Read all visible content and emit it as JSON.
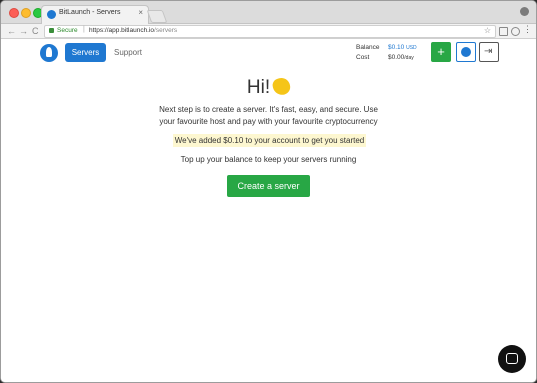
{
  "browser": {
    "tab_title": "BitLaunch - Servers",
    "tab_close": "×",
    "secure_label": "Secure",
    "url_host": "https://app.bitlaunch.io",
    "url_path": "/servers",
    "back_glyph": "←",
    "forward_glyph": "→",
    "reload_glyph": "C"
  },
  "nav": {
    "servers_label": "Servers",
    "support_label": "Support",
    "balance_label": "Balance",
    "balance_value": "$0.10",
    "balance_unit": "USD",
    "cost_label": "Cost",
    "cost_value": "$0.00",
    "cost_unit": "/day",
    "add_glyph": "+",
    "logout_glyph": "⇥"
  },
  "main": {
    "greeting": "Hi!",
    "line1": "Next step is to create a server. It's fast, easy, and secure. Use",
    "line2": "your favourite host and pay with your favourite cryptocurrency",
    "credit_notice": "We've added $0.10 to your account to get you started",
    "topup_text": "Top up your balance to keep your servers running",
    "create_button": "Create a server"
  },
  "colors": {
    "primary": "#1f78d1",
    "success": "#28a745",
    "highlight": "#fdf7d0"
  },
  "icons": [
    "rocket-logo-icon",
    "waving-hand-icon",
    "plus-icon",
    "avatar-circle-icon",
    "logout-icon",
    "chat-icon"
  ]
}
